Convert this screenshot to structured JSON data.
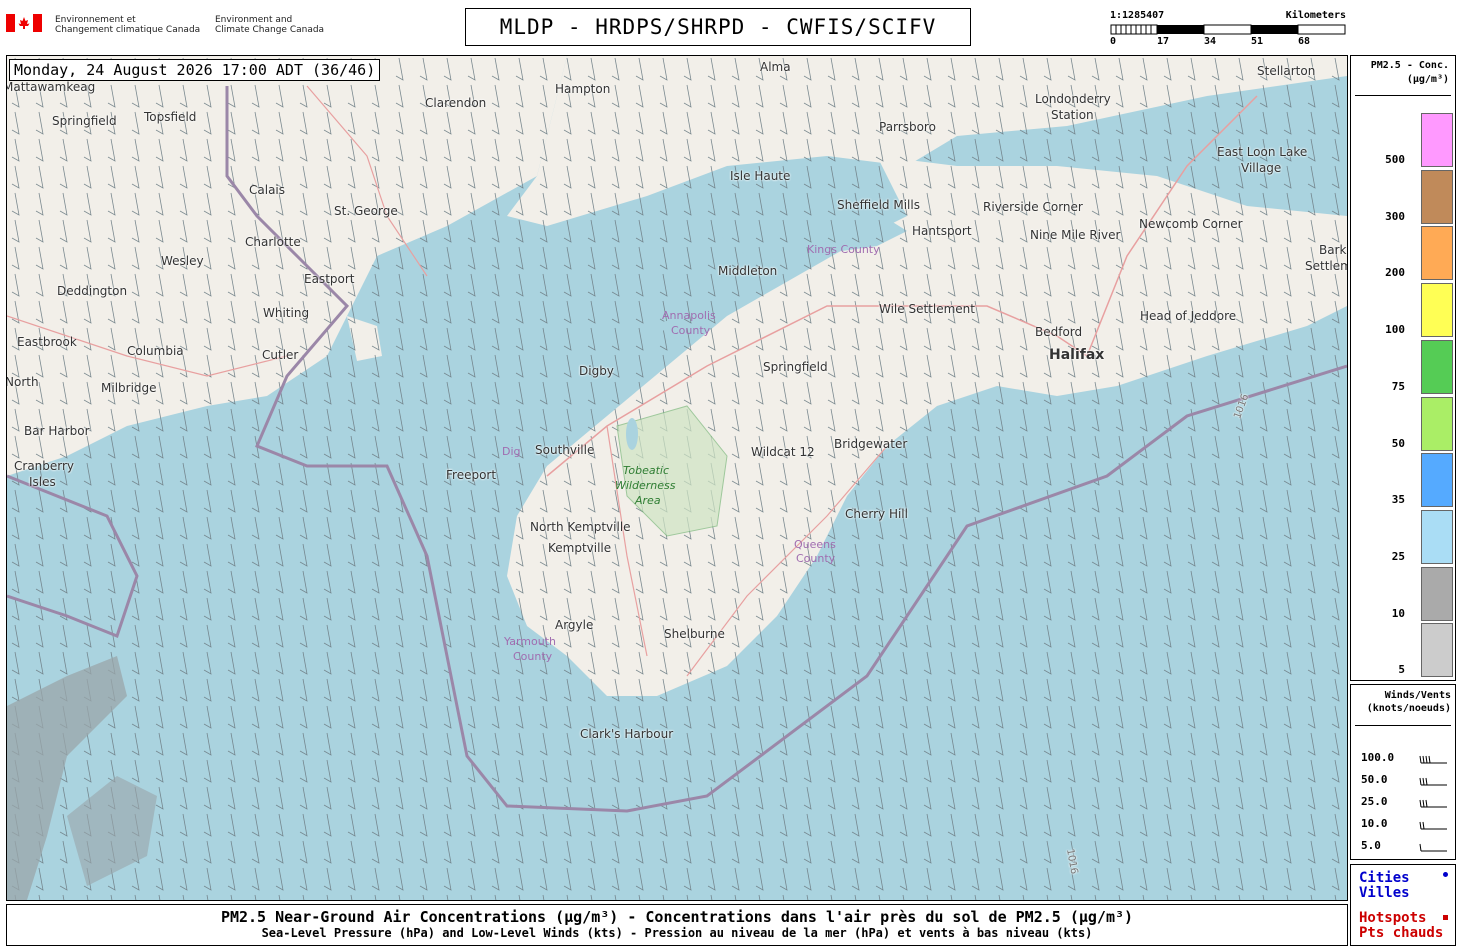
{
  "header": {
    "gov_fr_1": "Environnement et",
    "gov_fr_2": "Changement climatique Canada",
    "gov_en_1": "Environment and",
    "gov_en_2": "Climate Change Canada",
    "title": "MLDP - HRDPS/SHRPD - CWFIS/SCIFV",
    "scale_ratio": "1:1285407",
    "scale_unit": "Kilometers",
    "scale_ticks": [
      "0",
      "17",
      "34",
      "51",
      "68"
    ]
  },
  "map": {
    "datetime": "Monday, 24 August 2026 17:00 ADT (36/46)",
    "places": {
      "mattawamkeag": "Mattawamkeag",
      "springfield_me": "Springfield",
      "topsfield": "Topsfield",
      "clarendon": "Clarendon",
      "hampton": "Hampton",
      "alma": "Alma",
      "stellarton": "Stellarton",
      "londonderry": "Londonderry",
      "station": "Station",
      "parrsboro": "Parrsboro",
      "east_loon_lake": "East Loon Lake",
      "village": "Village",
      "isle_haute": "Isle Haute",
      "calais": "Calais",
      "st_george": "St. George",
      "sheffield_mills": "Sheffield Mills",
      "riverside_corner": "Riverside Corner",
      "charlotte": "Charlotte",
      "hantsport": "Hantsport",
      "nine_mile_river": "Nine Mile River",
      "newcomb_corner": "Newcomb Corner",
      "barkhouse": "Barkho",
      "settlement": "Settlem",
      "wesley": "Wesley",
      "eastport": "Eastport",
      "middleton": "Middleton",
      "deddington": "Deddington",
      "whiting": "Whiting",
      "wile_settlement": "Wile Settlement",
      "bedford": "Bedford",
      "head_of_jeddore": "Head of Jeddore",
      "eastbrook": "Eastbrook",
      "cutler": "Cutler",
      "columbia": "Columbia",
      "halifax": "Halifax",
      "digby": "Digby",
      "springfield_ns": "Springfield",
      "north": "North",
      "milbridge": "Milbridge",
      "bar_harbor": "Bar Harbor",
      "southville": "Southville",
      "wildcat": "Wildcat 12",
      "bridgewater": "Bridgewater",
      "cranberry": "Cranberry",
      "isles": "Isles",
      "freeport": "Freeport",
      "dig": "Dig",
      "cherry_hill": "Cherry Hill",
      "north_kemptville": "North Kemptville",
      "kemptville": "Kemptville",
      "argyle": "Argyle",
      "shelburne": "Shelburne",
      "clarks_harbour": "Clark's Harbour",
      "route_1": "1016",
      "route_2": "1016"
    },
    "counties": {
      "kings_1": "Kings County",
      "annapolis_1": "Annapolis",
      "annapolis_2": "County",
      "queens_1": "Queens",
      "queens_2": "County",
      "yarmouth_1": "Yarmouth",
      "yarmouth_2": "County"
    },
    "park": {
      "line1": "Tobeatic",
      "line2": "Wilderness",
      "line3": "Area"
    }
  },
  "legend": {
    "title_1": "PM2.5 - Conc.",
    "title_2": "(µg/m³)",
    "levels": [
      {
        "label": "500",
        "color": "#ff99ff"
      },
      {
        "label": "300",
        "color": "#c08a5a"
      },
      {
        "label": "200",
        "color": "#ffaa55"
      },
      {
        "label": "100",
        "color": "#ffff55"
      },
      {
        "label": "75",
        "color": "#55cc55"
      },
      {
        "label": "50",
        "color": "#aaee66"
      },
      {
        "label": "35",
        "color": "#55aaff"
      },
      {
        "label": "25",
        "color": "#aaddf5"
      },
      {
        "label": "10",
        "color": "#aaaaaa"
      },
      {
        "label": "5",
        "color": "#cccccc"
      }
    ]
  },
  "winds": {
    "title_1": "Winds/Vents",
    "title_2": "(knots/noeuds)",
    "rows": [
      "100.0",
      "50.0",
      "25.0",
      "10.0",
      "5.0"
    ]
  },
  "cities_box": {
    "cities": "Cities",
    "villes": "Villes",
    "hotspots": "Hotspots",
    "pts_chauds": "Pts chauds",
    "cities_color": "#0000cc",
    "hotspots_color": "#cc0000"
  },
  "footer": {
    "line1": "PM2.5 Near-Ground Air Concentrations (µg/m³) - Concentrations dans l'air près du sol de PM2.5 (µg/m³)",
    "line2": "Sea-Level Pressure (hPa) and Low-Level Winds (kts) - Pression au niveau de la mer (hPa) et vents à bas niveau (kts)"
  }
}
